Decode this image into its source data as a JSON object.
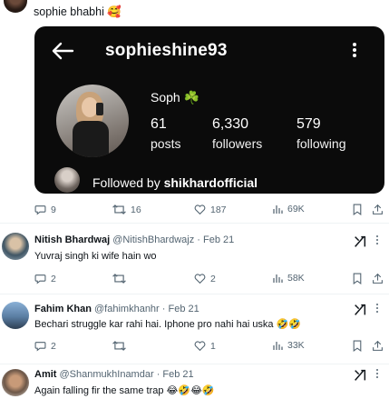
{
  "top_tweet": {
    "text": "sophie bhabhi 🥰",
    "instagram_card": {
      "username": "sophieshine93",
      "display_name": "Soph",
      "name_emoji": "☘️",
      "posts_count": "61",
      "posts_label": "posts",
      "followers_count": "6,330",
      "followers_label": "followers",
      "following_count": "579",
      "following_label": "following",
      "followed_by_prefix": "Followed by",
      "followed_by_user": "shikhardofficial"
    },
    "actions": {
      "replies": "9",
      "reposts": "16",
      "likes": "187",
      "views": "69K"
    }
  },
  "replies": [
    {
      "name": "Nitish Bhardwaj",
      "handle": "@NitishBhardwajz",
      "separator": "·",
      "date": "Feb 21",
      "text": "Yuvraj singh ki wife hain wo",
      "actions": {
        "replies": "2",
        "reposts": "",
        "likes": "2",
        "views": "58K"
      }
    },
    {
      "name": "Fahim Khan",
      "handle": "@fahimkhanhr",
      "separator": "·",
      "date": "Feb 21",
      "text": "Bechari struggle kar rahi hai. Iphone pro nahi hai uska 🤣🤣",
      "actions": {
        "replies": "2",
        "reposts": "",
        "likes": "1",
        "views": "33K"
      }
    },
    {
      "name": "Amit",
      "handle": "@ShanmukhInamdar",
      "separator": "·",
      "date": "Feb 21",
      "text": "Again falling fir the same trap 😂🤣😂🤣",
      "actions": {
        "replies": "",
        "reposts": "",
        "likes": "",
        "views": ""
      }
    }
  ],
  "icons": {
    "reply": "speech-bubble-icon",
    "repost": "repost-arrows-icon",
    "like": "heart-icon",
    "views": "bar-chart-icon",
    "bookmark": "bookmark-icon",
    "share": "share-upload-icon",
    "grok": "grok-icon",
    "more": "more-dots-icon"
  },
  "colors": {
    "text": "#0f1419",
    "secondary": "#536471",
    "card_bg": "#0b0b0b",
    "divider": "#eff3f4"
  }
}
